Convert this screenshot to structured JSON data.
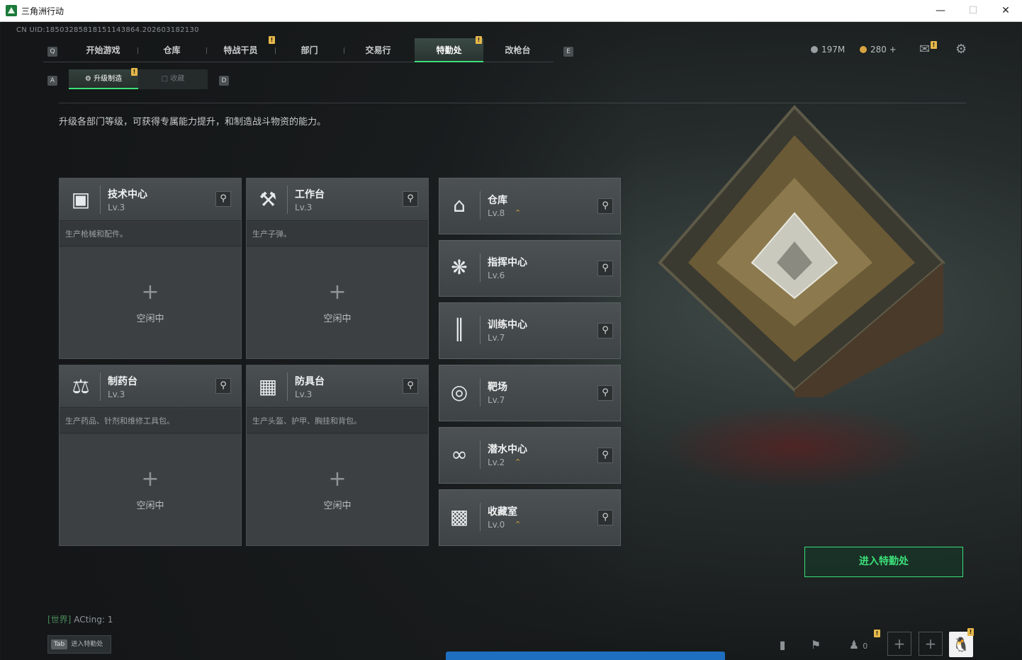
{
  "window": {
    "title": "三角洲行动"
  },
  "uid": "CN UID:18503285818151143864.202603182130",
  "nav": {
    "left_key": "Q",
    "right_key": "E",
    "items": [
      "开始游戏",
      "仓库",
      "特战干员",
      "部门",
      "交易行",
      "特勤处",
      "改枪台"
    ],
    "active": "特勤处"
  },
  "resources": {
    "currency1": "197M",
    "currency2": "280 +"
  },
  "subtabs": {
    "left_key": "A",
    "right_key": "D",
    "active": "升级制造",
    "inactive": "收藏"
  },
  "description": "升级各部门等级，可获得专属能力提升，和制造战斗物资的能力。",
  "workshops": [
    {
      "name": "技术中心",
      "level": "Lv.3",
      "desc": "生产枪械和配件。",
      "status": "空闲中",
      "icon": "monitor-icon"
    },
    {
      "name": "工作台",
      "level": "Lv.3",
      "desc": "生产子弹。",
      "status": "空闲中",
      "icon": "tools-icon"
    },
    {
      "name": "制药台",
      "level": "Lv.3",
      "desc": "生产药品、针剂和维修工具包。",
      "status": "空闲中",
      "icon": "microscope-icon"
    },
    {
      "name": "防具台",
      "level": "Lv.3",
      "desc": "生产头盔、护甲、胸挂和背包。",
      "status": "空闲中",
      "icon": "armor-icon"
    }
  ],
  "facilities": [
    {
      "name": "仓库",
      "level": "Lv.8",
      "upgradable": true,
      "icon": "warehouse-icon"
    },
    {
      "name": "指挥中心",
      "level": "Lv.6",
      "upgradable": false,
      "icon": "command-icon"
    },
    {
      "name": "训练中心",
      "level": "Lv.7",
      "upgradable": false,
      "icon": "dumbbell-icon"
    },
    {
      "name": "靶场",
      "level": "Lv.7",
      "upgradable": false,
      "icon": "target-icon"
    },
    {
      "name": "潜水中心",
      "level": "Lv.2",
      "upgradable": true,
      "icon": "diving-mask-icon"
    },
    {
      "name": "收藏室",
      "level": "Lv.0",
      "upgradable": true,
      "icon": "collection-icon"
    }
  ],
  "enter_button": "进入特勤处",
  "chat": {
    "channel": "[世界]",
    "message": "ACting: 1"
  },
  "tab_hint": {
    "key": "Tab",
    "label": "进入特勤处"
  },
  "friends_count": "0",
  "colors": {
    "accent": "#3ce07a",
    "badge": "#e6b84a",
    "upgrade": "#d8a440"
  }
}
